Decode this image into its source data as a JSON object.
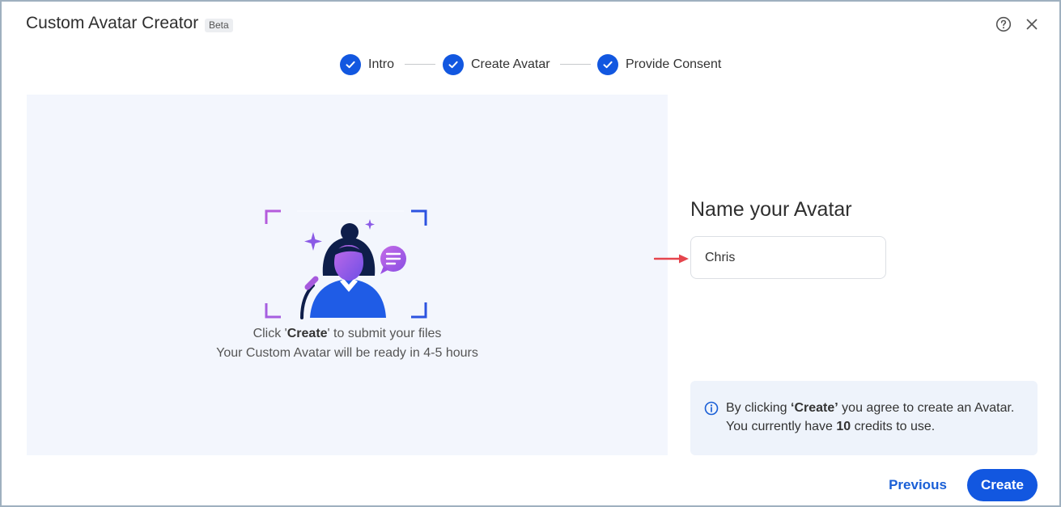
{
  "header": {
    "title": "Custom Avatar Creator",
    "badge": "Beta",
    "help_icon": "help-circle-icon",
    "close_icon": "close-icon"
  },
  "stepper": {
    "steps": [
      {
        "label": "Intro",
        "status": "complete"
      },
      {
        "label": "Create Avatar",
        "status": "complete"
      },
      {
        "label": "Provide Consent",
        "status": "complete"
      }
    ]
  },
  "preview": {
    "line1_prefix": "Click '",
    "line1_bold": "Create",
    "line1_suffix": "' to submit your files",
    "line2": "Your Custom Avatar will be ready in 4-5 hours"
  },
  "form": {
    "title": "Name your Avatar",
    "name_value": "Chris"
  },
  "notice": {
    "line1_prefix": "By clicking ",
    "line1_bold": "‘Create’",
    "line1_suffix": " you agree to create an Avatar.",
    "line2_prefix": "You currently have ",
    "line2_bold": "10",
    "line2_suffix": " credits to use."
  },
  "footer": {
    "previous_label": "Previous",
    "create_label": "Create"
  },
  "colors": {
    "primary": "#1257e0",
    "link": "#1a5fd6",
    "panel_bg": "#f3f6fd",
    "notice_bg": "#eef3fb",
    "annotation_arrow": "#e5454d"
  }
}
